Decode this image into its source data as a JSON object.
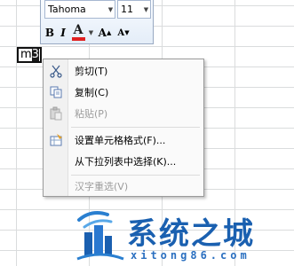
{
  "mini_toolbar": {
    "font_name": "Tahoma",
    "font_size": "11",
    "bold_label": "B",
    "italic_label": "I",
    "font_color_label": "A",
    "grow_label": "A",
    "shrink_label": "A",
    "font_color": "#e02020"
  },
  "cell": {
    "prefix": "m",
    "selected": "3"
  },
  "context_menu": {
    "items": [
      {
        "label": "剪切(T)",
        "icon": "scissors-icon",
        "enabled": true
      },
      {
        "label": "复制(C)",
        "icon": "copy-icon",
        "enabled": true
      },
      {
        "label": "粘贴(P)",
        "icon": "paste-icon",
        "enabled": false
      },
      {
        "label": "设置单元格格式(F)...",
        "icon": "format-cells-icon",
        "enabled": true
      },
      {
        "label": "从下拉列表中选择(K)...",
        "icon": "",
        "enabled": true
      },
      {
        "label": "汉字重选(V)",
        "icon": "",
        "enabled": false
      }
    ]
  },
  "watermark": {
    "title": "系统之城",
    "url": "xitong86.com",
    "color": "#1a60b0"
  }
}
